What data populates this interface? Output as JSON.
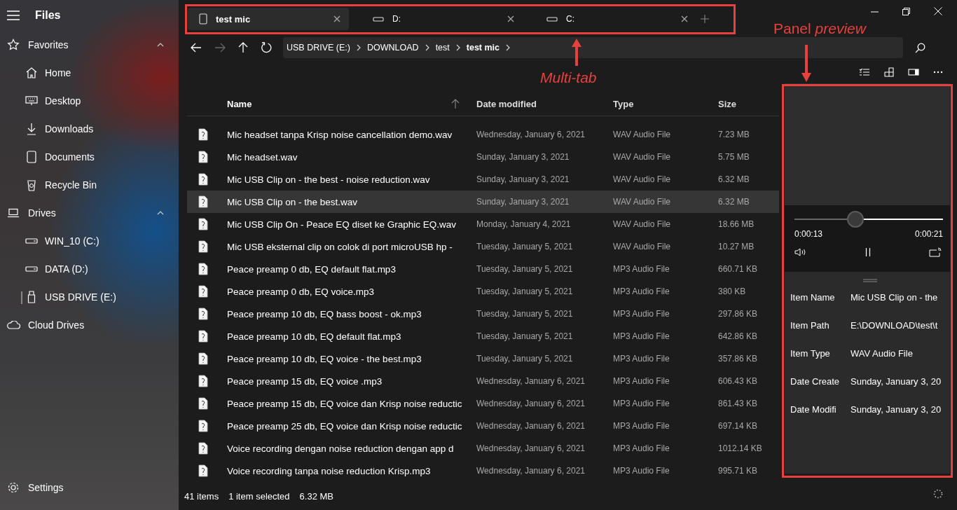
{
  "app": {
    "title": "Files"
  },
  "sidebar": {
    "sections": [
      {
        "label": "Favorites",
        "expanded": true,
        "children": [
          {
            "label": "Home",
            "selected": false
          },
          {
            "label": "Desktop",
            "selected": false
          },
          {
            "label": "Downloads",
            "selected": false
          },
          {
            "label": "Documents",
            "selected": false
          },
          {
            "label": "Recycle Bin",
            "selected": false
          }
        ]
      },
      {
        "label": "Drives",
        "expanded": true,
        "children": [
          {
            "label": "WIN_10 (C:)",
            "selected": false
          },
          {
            "label": "DATA (D:)",
            "selected": false
          },
          {
            "label": "USB DRIVE (E:)",
            "selected": true
          }
        ]
      }
    ],
    "cloud_drives": {
      "label": "Cloud Drives"
    },
    "settings": {
      "label": "Settings"
    }
  },
  "tabs": [
    {
      "label": "test mic",
      "selected": true
    },
    {
      "label": "D:",
      "selected": false
    },
    {
      "label": "C:",
      "selected": false
    }
  ],
  "breadcrumb": [
    "USB DRIVE (E:)",
    "DOWNLOAD",
    "test",
    "test mic"
  ],
  "table": {
    "columns": [
      {
        "label": "Name",
        "sorted": true
      },
      {
        "label": "Date modified",
        "sorted": false
      },
      {
        "label": "Type",
        "sorted": false
      },
      {
        "label": "Size",
        "sorted": false
      }
    ],
    "rows": [
      {
        "name": "Mic headset tanpa Krisp noise cancellation demo.wav",
        "date": "Wednesday, January 6, 2021",
        "type": "WAV Audio File",
        "size": "7.23 MB",
        "selected": false
      },
      {
        "name": "Mic headset.wav",
        "date": "Sunday, January 3, 2021",
        "type": "WAV Audio File",
        "size": "5.75 MB",
        "selected": false
      },
      {
        "name": "Mic USB Clip on -  the best - noise reduction.wav",
        "date": "Sunday, January 3, 2021",
        "type": "WAV Audio File",
        "size": "6.32 MB",
        "selected": false
      },
      {
        "name": "Mic USB Clip on -  the best.wav",
        "date": "Sunday, January 3, 2021",
        "type": "WAV Audio File",
        "size": "6.32 MB",
        "selected": true
      },
      {
        "name": "Mic USB Clip On - Peace EQ diset ke Graphic EQ.wav",
        "date": "Monday, January 4, 2021",
        "type": "WAV Audio File",
        "size": "18.66 MB",
        "selected": false
      },
      {
        "name": "Mic USB eksternal clip on colok di port microUSB hp -",
        "date": "Tuesday, January 5, 2021",
        "type": "WAV Audio File",
        "size": "10.27 MB",
        "selected": false
      },
      {
        "name": "Peace preamp 0 db, EQ default flat.mp3",
        "date": "Tuesday, January 5, 2021",
        "type": "MP3 Audio File",
        "size": "660.71 KB",
        "selected": false
      },
      {
        "name": "Peace preamp 0 db, EQ voice.mp3",
        "date": "Tuesday, January 5, 2021",
        "type": "MP3 Audio File",
        "size": "380 KB",
        "selected": false
      },
      {
        "name": "Peace preamp 10 db, EQ bass boost - ok.mp3",
        "date": "Tuesday, January 5, 2021",
        "type": "MP3 Audio File",
        "size": "297.86 KB",
        "selected": false
      },
      {
        "name": "Peace preamp 10 db, EQ default flat.mp3",
        "date": "Tuesday, January 5, 2021",
        "type": "MP3 Audio File",
        "size": "642.86 KB",
        "selected": false
      },
      {
        "name": "Peace preamp 10 db, EQ voice - the best.mp3",
        "date": "Tuesday, January 5, 2021",
        "type": "MP3 Audio File",
        "size": "357.86 KB",
        "selected": false
      },
      {
        "name": "Peace preamp 15 db, EQ voice .mp3",
        "date": "Wednesday, January 6, 2021",
        "type": "MP3 Audio File",
        "size": "606.43 KB",
        "selected": false
      },
      {
        "name": "Peace preamp 15 db, EQ voice dan Krisp noise reductic",
        "date": "Wednesday, January 6, 2021",
        "type": "MP3 Audio File",
        "size": "861.43 KB",
        "selected": false
      },
      {
        "name": "Peace preamp 25 db, EQ voice dan Krisp noise reductic",
        "date": "Wednesday, January 6, 2021",
        "type": "MP3 Audio File",
        "size": "697.14 KB",
        "selected": false
      },
      {
        "name": "Voice recording dengan noise reduction dengan app d",
        "date": "Wednesday, January 6, 2021",
        "type": "MP3 Audio File",
        "size": "1012.14 KB",
        "selected": false
      },
      {
        "name": "Voice recording tanpa noise reduction Krisp.mp3",
        "date": "Wednesday, January 6, 2021",
        "type": "MP3 Audio File",
        "size": "995.71 KB",
        "selected": false
      }
    ]
  },
  "status_bar": {
    "item_count": "41 items",
    "selection": "1 item selected",
    "selection_size": "6.32 MB"
  },
  "preview": {
    "media": {
      "level": 0.41,
      "elapsed": "0:00:13",
      "duration": "0:00:21",
      "playing": true
    },
    "details": [
      {
        "label": "Item Name",
        "value": "Mic USB Clip on -  the"
      },
      {
        "label": "Item Path",
        "value": "E:\\DOWNLOAD\\test\\t"
      },
      {
        "label": "Item Type",
        "value": "WAV Audio File"
      },
      {
        "label": "Date Create",
        "value": "Sunday, January 3, 20"
      },
      {
        "label": "Date Modifi",
        "value": "Sunday, January 3, 20"
      }
    ]
  },
  "annotations": [
    {
      "text": "Multi-tab"
    },
    {
      "text": "Panel *preview*"
    }
  ]
}
